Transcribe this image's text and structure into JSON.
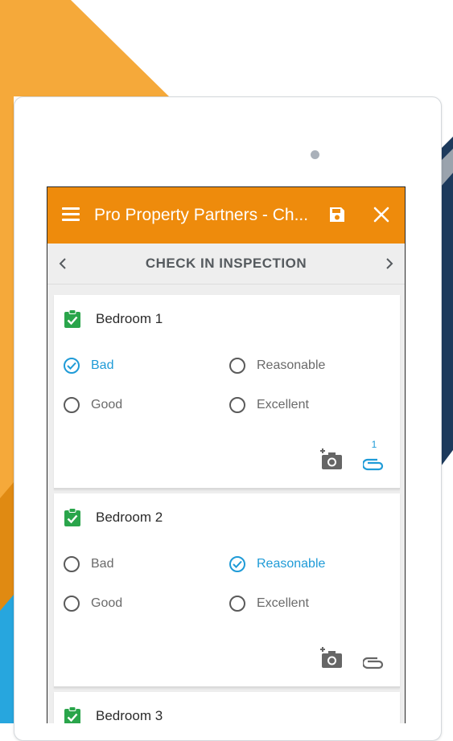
{
  "app": {
    "title": "Pro Property Partners - Ch...",
    "section_title": "CHECK IN INSPECTION"
  },
  "colors": {
    "appbar": "#ee8b0c",
    "accent": "#1f9bd7",
    "check_green": "#2aa54b",
    "bg_orange": "#f5a93a",
    "bg_navy": "#1d3a5c",
    "bg_blue": "#27a6de"
  },
  "icons": {
    "menu": "menu-icon",
    "save": "save-icon",
    "close": "close-icon",
    "prev": "chevron-left-icon",
    "next": "chevron-right-icon",
    "room_done": "clipboard-check-icon",
    "add_photo": "add-photo-icon",
    "attachment": "paperclip-icon"
  },
  "rooms": [
    {
      "name": "Bedroom 1",
      "options": [
        "Bad",
        "Reasonable",
        "Good",
        "Excellent"
      ],
      "selected": "Bad",
      "attachment_count": "1"
    },
    {
      "name": "Bedroom 2",
      "options": [
        "Bad",
        "Reasonable",
        "Good",
        "Excellent"
      ],
      "selected": "Reasonable",
      "attachment_count": ""
    },
    {
      "name": "Bedroom 3"
    }
  ]
}
